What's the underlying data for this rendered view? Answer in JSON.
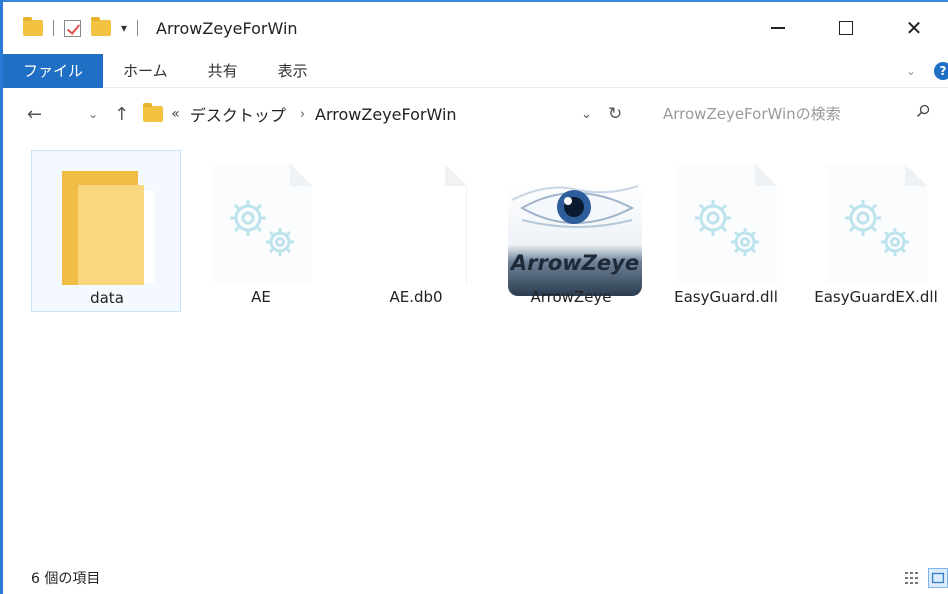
{
  "window": {
    "title": "ArrowZeyeForWin",
    "minimize_label": "",
    "close_glyph": "✕"
  },
  "ribbon": {
    "tabs": [
      {
        "label": "ファイル",
        "active": true
      },
      {
        "label": "ホーム"
      },
      {
        "label": "共有"
      },
      {
        "label": "表示"
      }
    ],
    "collapse_glyph": "⌄",
    "help_glyph": "?",
    "accent_color": "#1f6fc5"
  },
  "address": {
    "back_glyph": "←",
    "recent_glyph": "⌄",
    "up_glyph": "↑",
    "more_glyph": "«",
    "breadcrumbs": [
      "デスクトップ",
      "ArrowZeyeForWin"
    ],
    "separator": "›",
    "dropdown_glyph": "⌄",
    "refresh_glyph": "↻"
  },
  "search": {
    "placeholder": "ArrowZeyeForWinの検索"
  },
  "files": [
    {
      "name": "data",
      "icon": "folder-icon",
      "selected": true
    },
    {
      "name": "AE",
      "icon": "gear-file-icon"
    },
    {
      "name": "AE.db0",
      "icon": "blank-file-icon"
    },
    {
      "name": "ArrowZeye",
      "icon": "arrowzeye-app-icon"
    },
    {
      "name": "EasyGuard.dll",
      "icon": "gear-file-icon"
    },
    {
      "name": "EasyGuardEX.dll",
      "icon": "gear-file-icon"
    }
  ],
  "app_icon_text": "ArrowZeye",
  "status": {
    "item_count_text": "6 個の項目"
  }
}
